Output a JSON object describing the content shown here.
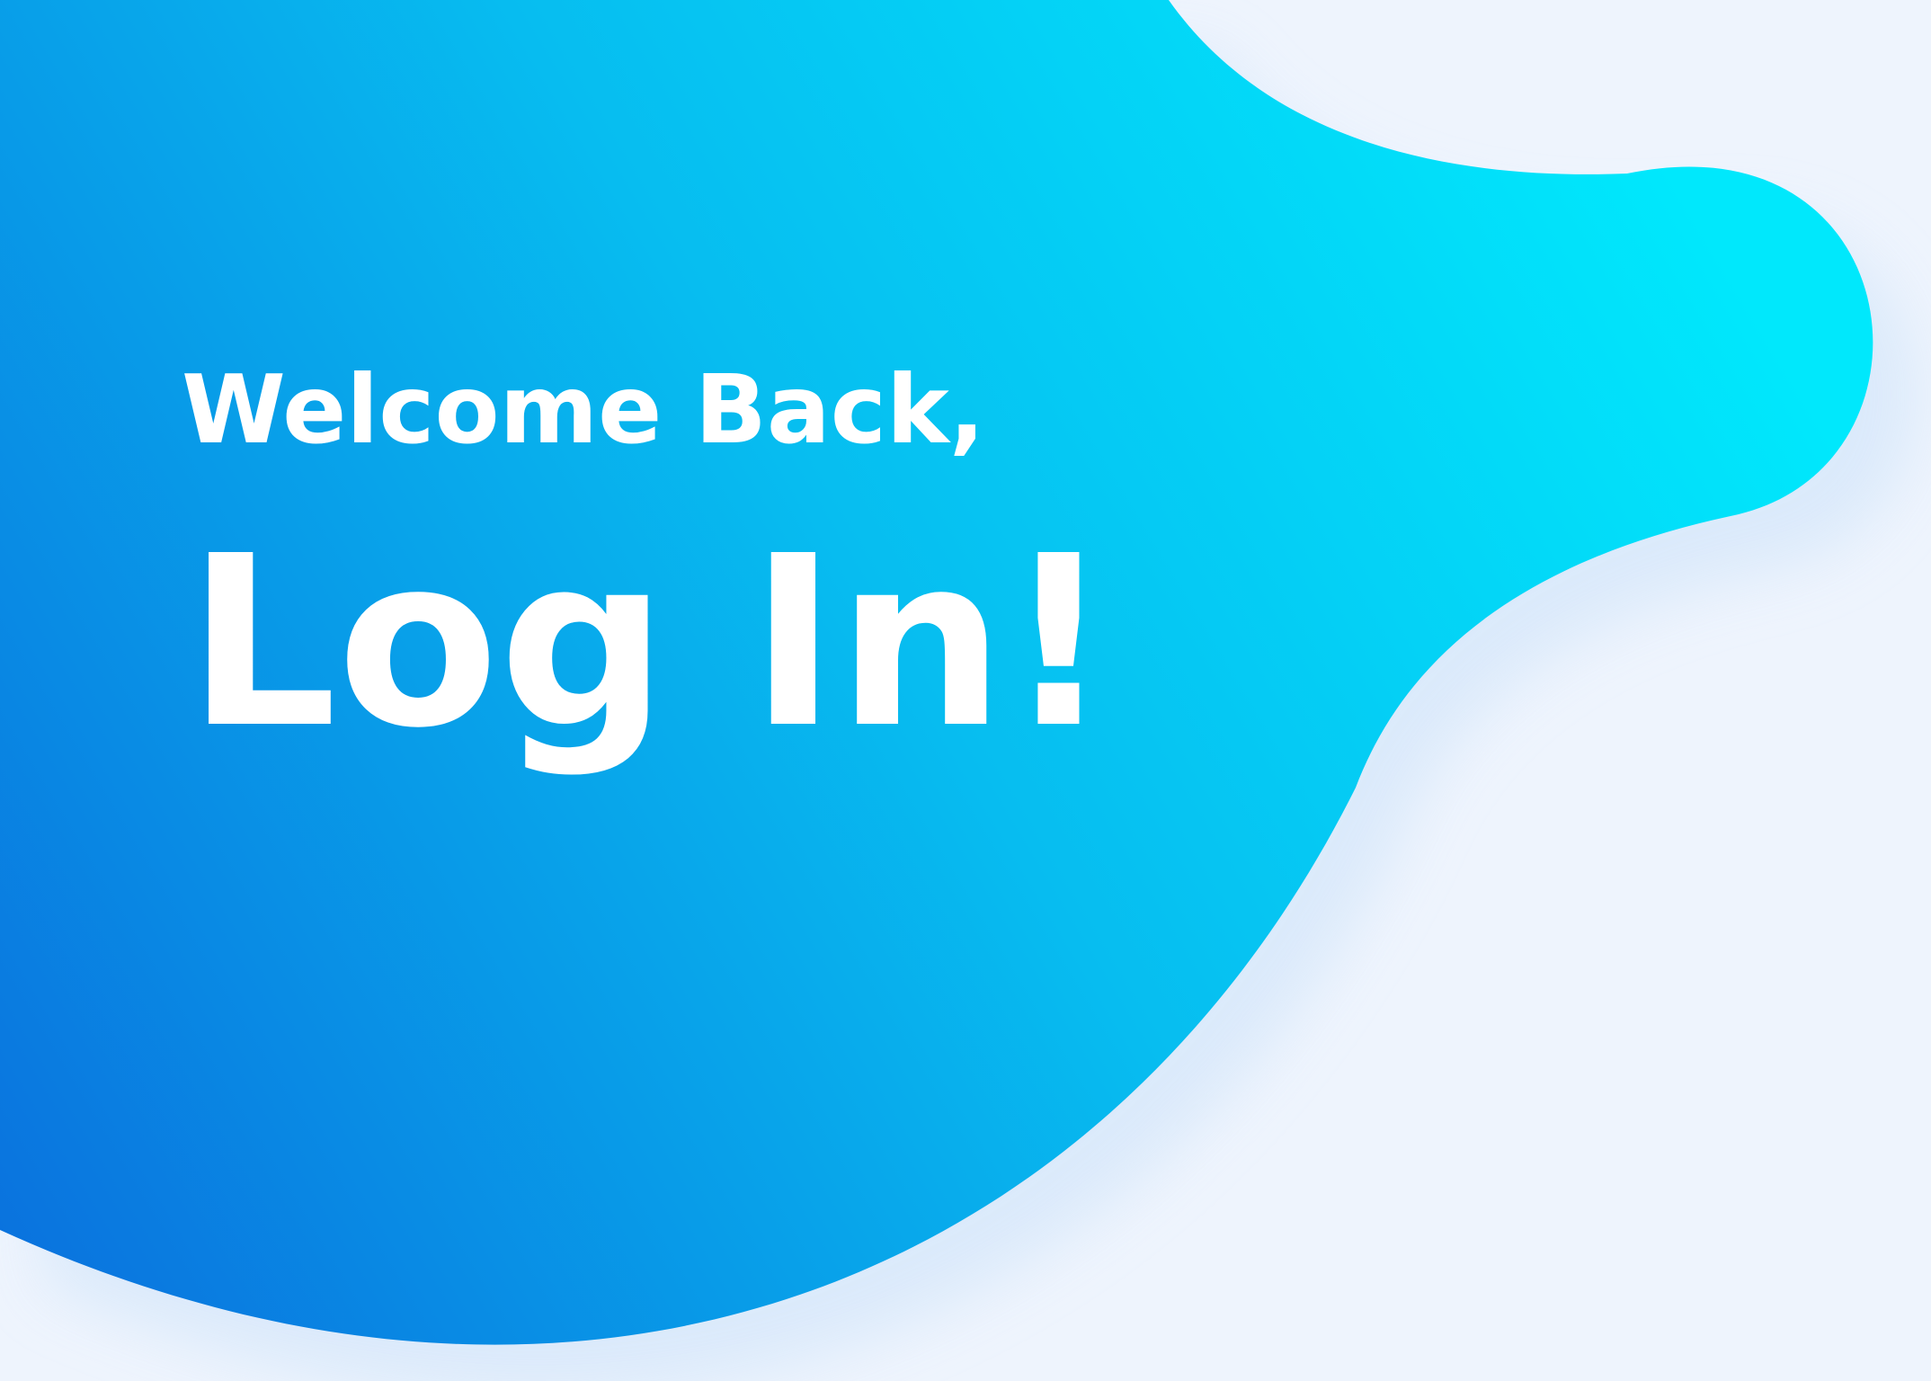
{
  "colors": {
    "background": "#eef4fd",
    "blob_gradient_start": "#0a72de",
    "blob_gradient_end": "#00e8fc",
    "text": "#ffffff"
  },
  "hero": {
    "greeting": "Welcome Back,",
    "headline": "Log In!"
  }
}
